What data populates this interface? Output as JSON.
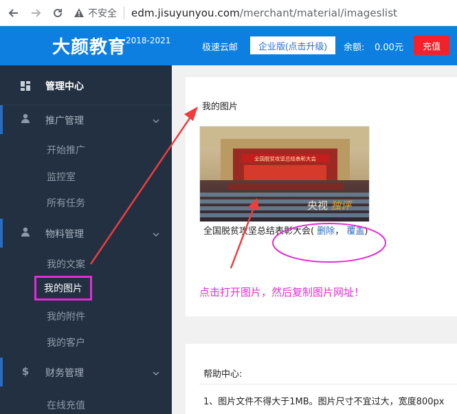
{
  "browser": {
    "insecure_label": "不安全",
    "url_host": "edm.jisuyunyou.com",
    "url_path": "/merchant/material/imageslist"
  },
  "header": {
    "brand": "大颜教育",
    "years": "2018-2021",
    "cloud_label": "极速云邮",
    "upgrade_button": "企业版(点击升级)",
    "balance_label": "余额:",
    "balance_value": "0.00元",
    "recharge_button": "充值",
    "colors": {
      "header_bg": "#0c7fe0",
      "recharge_bg": "#f0232b"
    }
  },
  "sidebar": {
    "title": "管理中心",
    "groups": [
      {
        "label": "推广管理",
        "icon": "user-icon",
        "items": [
          "开始推广",
          "监控室",
          "所有任务"
        ]
      },
      {
        "label": "物料管理",
        "icon": "user-icon",
        "items": [
          "我的文案",
          "我的图片",
          "我的附件",
          "我的客户"
        ]
      },
      {
        "label": "财务管理",
        "icon": "dollar-icon",
        "items": [
          "在线充值"
        ]
      }
    ],
    "active_item": "我的图片"
  },
  "main": {
    "images_card": {
      "title": "我的图片",
      "image_caption_title": "全国脱贫攻坚总结表彰大会(",
      "delete_link": "删除",
      "separator": "，",
      "cover_link": "覆盖",
      "caption_close": ")",
      "image_banner_text": "全国脱贫攻坚总结表彰大会",
      "image_watermark": "央视",
      "image_watermark_highlight": "独评"
    },
    "annotation_hint": "点击打开图片，然后复制图片网址！",
    "help_card": {
      "title": "帮助中心:",
      "line1": "1、图片文件不得大于1MB。图片尺寸不宜过大，宽度800px"
    }
  },
  "annotations": {
    "color": "#e52bd8",
    "arrow_color": "#f03d3d"
  }
}
